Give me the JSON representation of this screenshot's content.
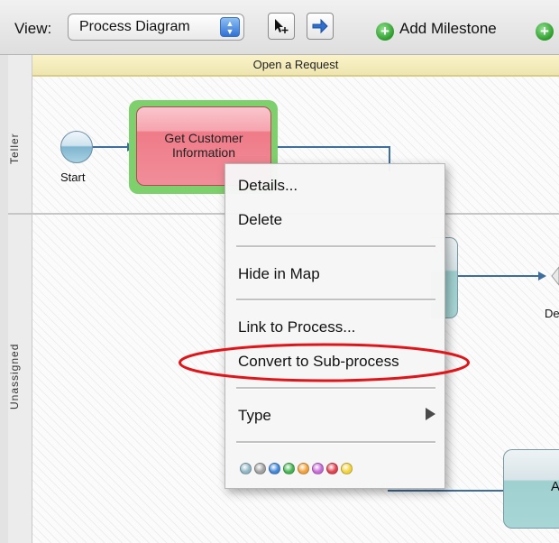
{
  "toolbar": {
    "view_label": "View:",
    "view_value": "Process Diagram",
    "add_milestone_label": "Add Milestone"
  },
  "milestone": {
    "title": "Open a Request"
  },
  "lanes": {
    "top": "Teller",
    "bottom": "Unassigned"
  },
  "diagram": {
    "start_label": "Start",
    "task_title": "Get Customer Information",
    "task_br_label": "A",
    "gateway_label": "De"
  },
  "context_menu": {
    "items": [
      "Details...",
      "Delete",
      "Hide in Map",
      "Link to Process...",
      "Convert to Sub-process",
      "Type"
    ],
    "highlighted_item": "Convert to Sub-process",
    "color_swatches": [
      "#8fb6c6",
      "#a0a0a0",
      "#3f86d9",
      "#45b552",
      "#f0a23a",
      "#c76ad8",
      "#e0424f",
      "#f2d23a"
    ]
  },
  "icons": {
    "view_stepper": "up-down-stepper-icon",
    "select_tool": "pointer-select-icon",
    "connect_tool": "arrow-connect-icon",
    "add": "green-plus-icon",
    "submenu": "submenu-arrow-icon"
  },
  "colors": {
    "task_selected_outline": "#7ed06c",
    "task_fill": "#ef7b88",
    "highlight_oval": "#e0151a",
    "milestone_bar": "#f5ecbf"
  }
}
